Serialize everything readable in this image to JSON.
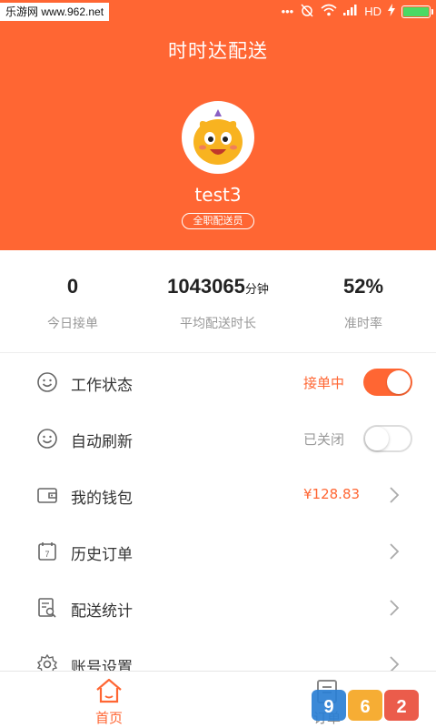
{
  "status_bar": {
    "watermark": "乐游网 www.962.net",
    "network": "HD",
    "accent_battery": "#4cd964"
  },
  "header": {
    "title": "时时达配送",
    "username": "test3",
    "role": "全职配送员",
    "bg_color": "#ff6633"
  },
  "stats": [
    {
      "value": "0",
      "unit": "",
      "label": "今日接单"
    },
    {
      "value": "1043065",
      "unit": "分钟",
      "label": "平均配送时长"
    },
    {
      "value": "52%",
      "unit": "",
      "label": "准时率"
    }
  ],
  "menu": {
    "work_status": {
      "label": "工作状态",
      "status": "接单中",
      "toggle": "on",
      "icon": "smiley-icon"
    },
    "auto_refresh": {
      "label": "自动刷新",
      "status": "已关闭",
      "toggle": "off",
      "icon": "smiley-icon"
    },
    "wallet": {
      "label": "我的钱包",
      "amount": "¥128.83",
      "icon": "wallet-icon"
    },
    "history": {
      "label": "历史订单",
      "icon": "calendar-icon"
    },
    "stats": {
      "label": "配送统计",
      "icon": "report-icon"
    },
    "settings": {
      "label": "账号设置",
      "icon": "gear-icon"
    }
  },
  "bottom_nav": {
    "home": "首页",
    "orders": "订单"
  },
  "colors": {
    "accent": "#ff6633",
    "muted": "#999999"
  }
}
